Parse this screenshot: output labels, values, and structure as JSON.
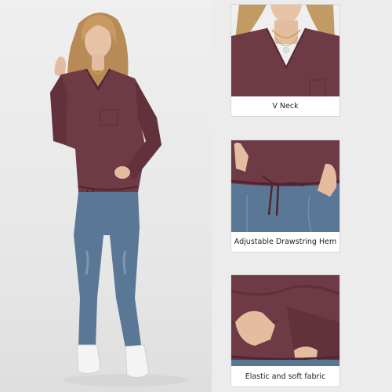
{
  "main_image": {
    "subject": "model-wearing-sweater"
  },
  "detail_panels": [
    {
      "caption": "V Neck"
    },
    {
      "caption": "Adjustable Drawstring Hem"
    },
    {
      "caption": "Elastic and soft fabric"
    }
  ],
  "colors": {
    "sweater": "#6e3a45",
    "jeans": "#5a7896",
    "background": "#ececec",
    "caption_bg": "#ffffff",
    "caption_text": "#222222"
  }
}
